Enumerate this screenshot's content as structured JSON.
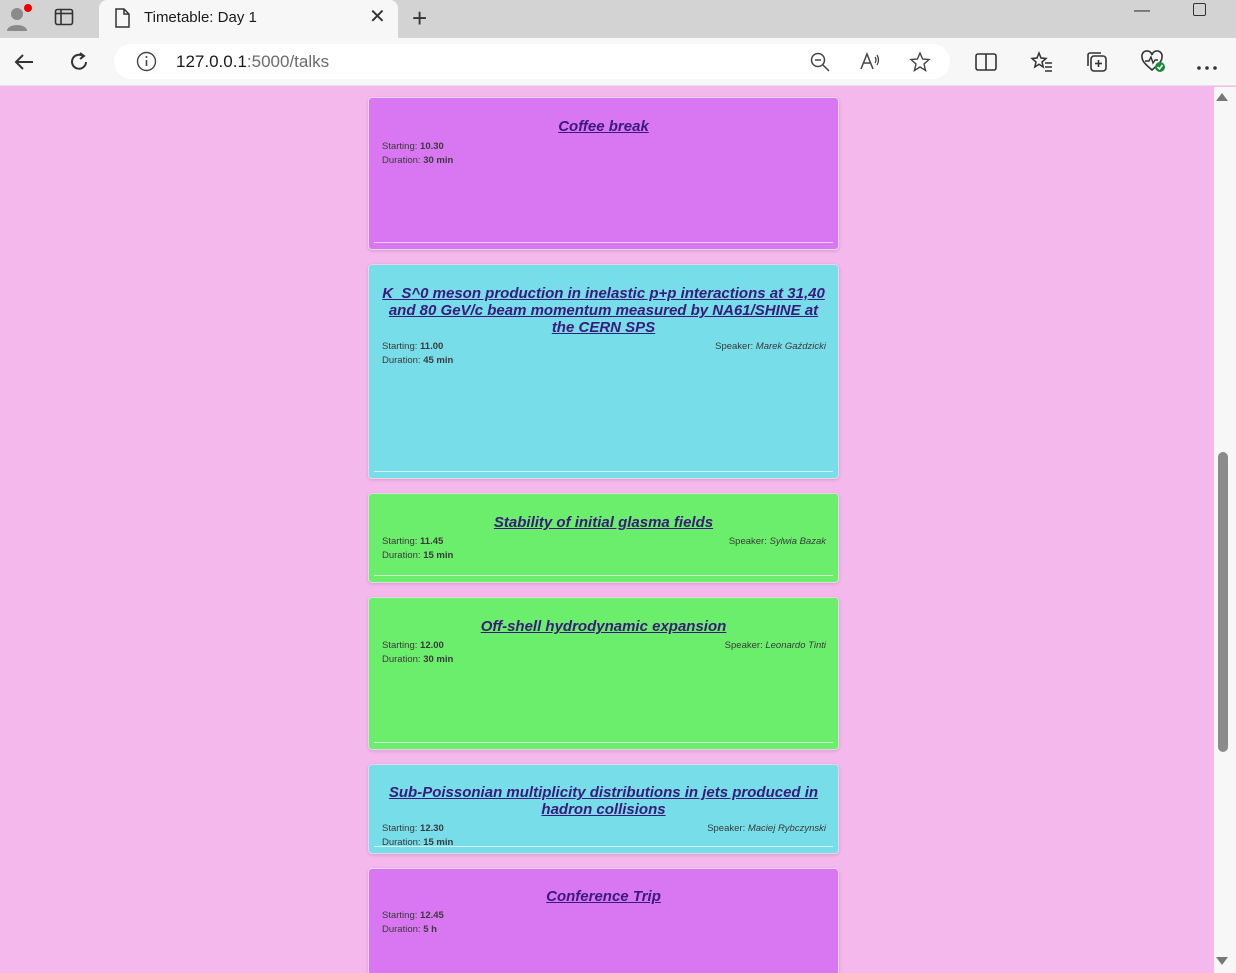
{
  "browser": {
    "tab_title": "Timetable: Day 1",
    "url_host": "127.0.0.1",
    "url_rest": ":5000/talks"
  },
  "labels": {
    "starting": "Starting: ",
    "duration": "Duration: ",
    "speaker": "Speaker: "
  },
  "talks": [
    {
      "title": "Coffee break",
      "start": "10.30",
      "duration": "30 min",
      "speaker": "",
      "color": "#d977f2"
    },
    {
      "title": "K_S^0 meson production in inelastic p+p interactions at 31,40 and 80 GeV/c beam momentum measured by NA61/SHINE at the CERN SPS",
      "start": "11.00",
      "duration": "45 min",
      "speaker": "Marek Gaździcki",
      "color": "#77dde8"
    },
    {
      "title": "Stability of initial glasma fields",
      "start": "11.45",
      "duration": "15 min",
      "speaker": "Sylwia Bazak",
      "color": "#6bee6b"
    },
    {
      "title": "Off-shell hydrodynamic expansion",
      "start": "12.00",
      "duration": "30 min",
      "speaker": "Leonardo Tinti",
      "color": "#6bee6b"
    },
    {
      "title": "Sub-Poissonian multiplicity distributions in jets produced in hadron collisions",
      "start": "12.30",
      "duration": "15 min",
      "speaker": "Maciej Rybczynski",
      "color": "#77dde8"
    },
    {
      "title": "Conference Trip",
      "start": "12.45",
      "duration": "5 h",
      "speaker": "",
      "color": "#d977f2"
    }
  ]
}
